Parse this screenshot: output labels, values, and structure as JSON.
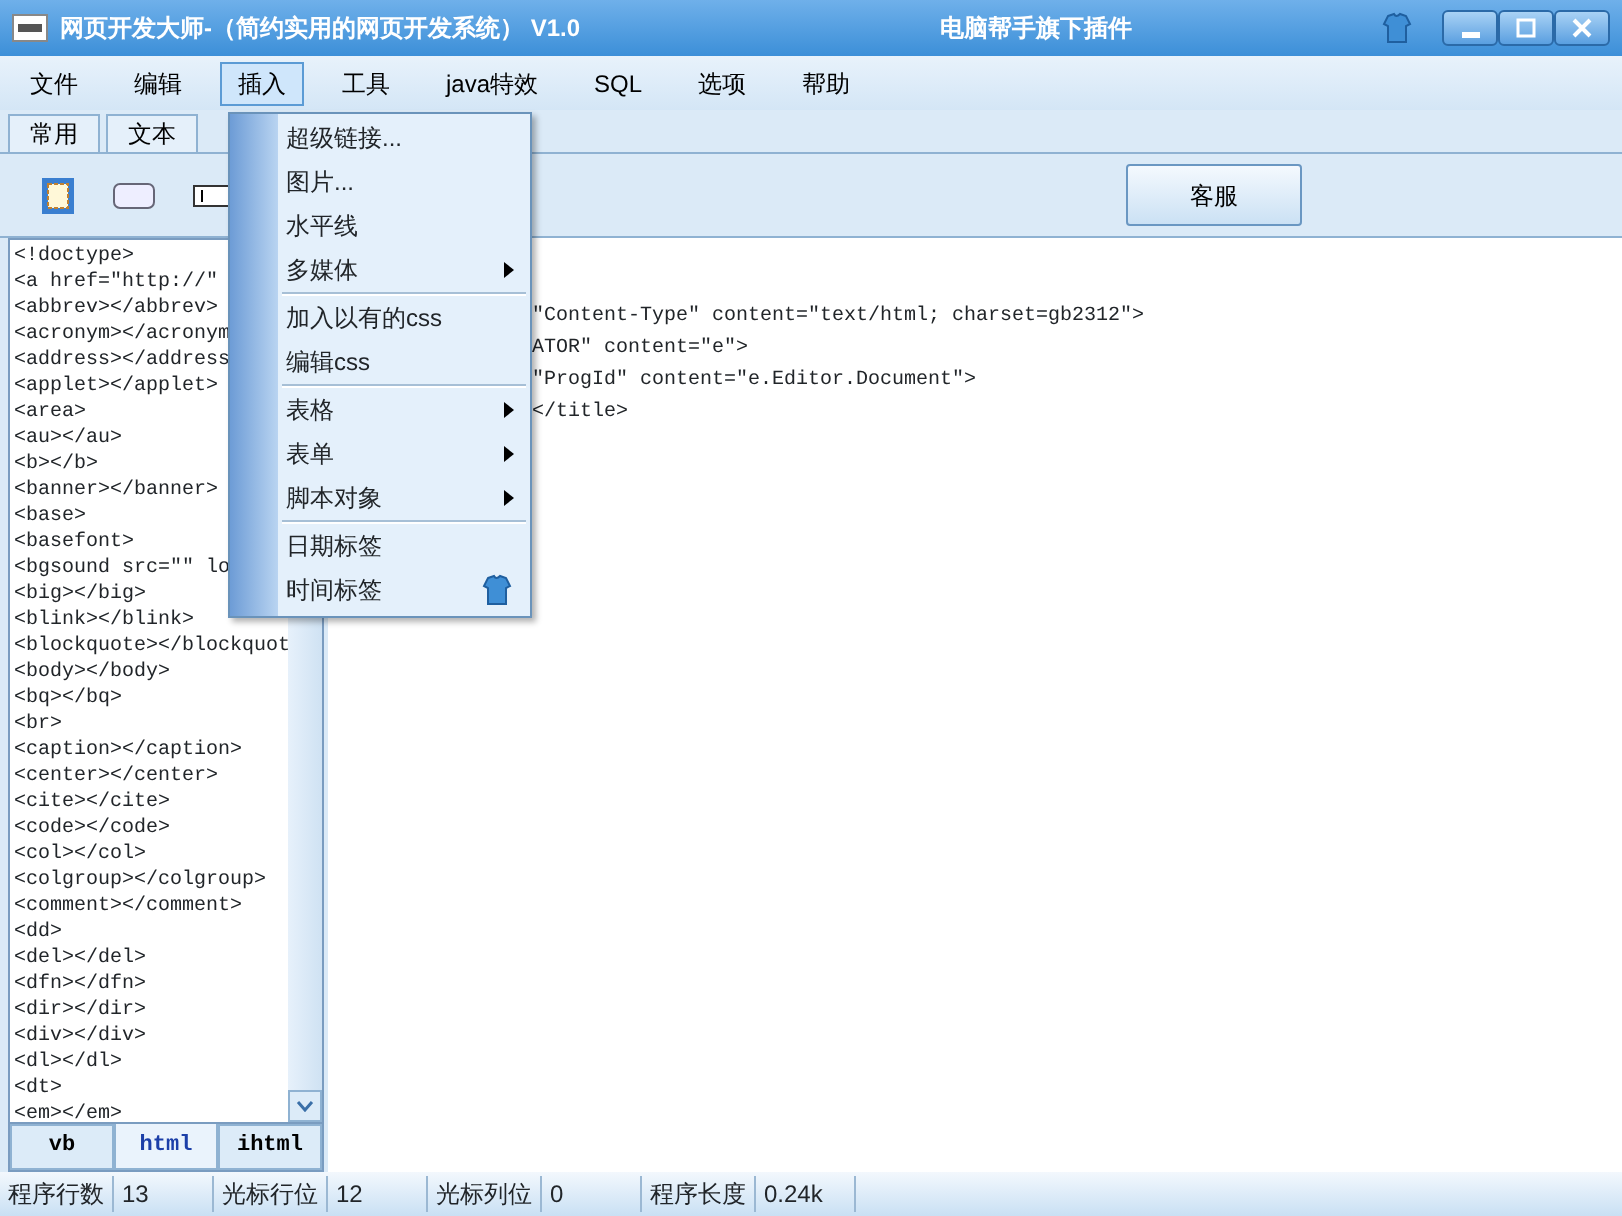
{
  "window": {
    "title": "网页开发大师-（简约实用的网页开发系统） V1.0",
    "subtitle": "电脑帮手旗下插件"
  },
  "menu_bar": [
    {
      "label": "文件",
      "selected": false
    },
    {
      "label": "编辑",
      "selected": false
    },
    {
      "label": "插入",
      "selected": true
    },
    {
      "label": "工具",
      "selected": false
    },
    {
      "label": "java特效",
      "selected": false
    },
    {
      "label": "SQL",
      "selected": false
    },
    {
      "label": "选项",
      "selected": false
    },
    {
      "label": "帮助",
      "selected": false
    }
  ],
  "top_tabs": [
    {
      "label": "常用",
      "selected": false
    },
    {
      "label": "文本",
      "selected": false
    }
  ],
  "service_button": "客服",
  "insert_menu": [
    {
      "kind": "item",
      "label": "超级链接...",
      "submenu": false
    },
    {
      "kind": "item",
      "label": "图片...",
      "submenu": false
    },
    {
      "kind": "item",
      "label": "水平线",
      "submenu": false
    },
    {
      "kind": "item",
      "label": "多媒体",
      "submenu": true
    },
    {
      "kind": "separator"
    },
    {
      "kind": "item",
      "label": "加入以有的css",
      "submenu": false
    },
    {
      "kind": "item",
      "label": "编辑css",
      "submenu": false
    },
    {
      "kind": "separator"
    },
    {
      "kind": "item",
      "label": "表格",
      "submenu": true
    },
    {
      "kind": "item",
      "label": "表单",
      "submenu": true
    },
    {
      "kind": "item",
      "label": "脚本对象",
      "submenu": true
    },
    {
      "kind": "separator"
    },
    {
      "kind": "item",
      "label": "日期标签",
      "submenu": false
    },
    {
      "kind": "item",
      "label": "时间标签",
      "submenu": false,
      "icon": true
    }
  ],
  "tag_list": [
    "<!doctype>",
    "<a href=\"http://\"",
    "<abbrev></abbrev>",
    "<acronym></acronym",
    "<address></address",
    "<applet></applet>",
    "<area>",
    "<au></au>",
    "<b></b>",
    "<banner></banner>",
    "<base>",
    "<basefont>",
    "<bgsound src=\"\" lo",
    "<big></big>",
    "<blink></blink>",
    "<blockquote></blockquot",
    "<body></body>",
    "<bq></bq>",
    "<br>",
    "<caption></caption>",
    "<center></center>",
    "<cite></cite>",
    "<code></code>",
    "<col></col>",
    "<colgroup></colgroup>",
    "<comment></comment>",
    "<dd>",
    "<del></del>",
    "<dfn></dfn>",
    "<dir></dir>",
    "<div></div>",
    "<dl></dl>",
    "<dt>",
    "<em></em>"
  ],
  "bottom_tabs": [
    {
      "label": "vb",
      "selected": false
    },
    {
      "label": "html",
      "selected": true
    },
    {
      "label": "ihtml",
      "selected": false
    }
  ],
  "editor_lines": [
    "\"Content-Type\" content=\"text/html; charset=gb2312\">",
    "ATOR\" content=\"e\">",
    "\"ProgId\" content=\"e.Editor.Document\">",
    "</title>"
  ],
  "status_bar": [
    {
      "label": "程序行数",
      "value": "13"
    },
    {
      "label": "光标行位",
      "value": "12"
    },
    {
      "label": "光标列位",
      "value": "0"
    },
    {
      "label": "程序长度",
      "value": "0.24k"
    }
  ]
}
